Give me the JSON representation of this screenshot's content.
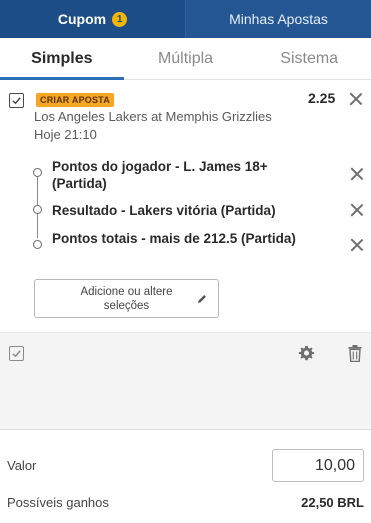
{
  "header": {
    "tabs": [
      {
        "label": "Cupom",
        "badge": "1"
      },
      {
        "label": "Minhas Apostas"
      }
    ]
  },
  "bet_type_tabs": [
    {
      "label": "Simples"
    },
    {
      "label": "Múltipla"
    },
    {
      "label": "Sistema"
    }
  ],
  "bet": {
    "tag": "CRIAR APOSTA",
    "odds": "2.25",
    "match": "Los Angeles Lakers at Memphis Grizzlies",
    "time": "Hoje 21:10",
    "selections": [
      {
        "label": "Pontos do jogador - L. James 18+ (Partida)"
      },
      {
        "label": "Resultado - Lakers vitória (Partida)"
      },
      {
        "label": "Pontos totais - mais de 212.5 (Partida)"
      }
    ],
    "edit_button": "Adicione ou altere seleções"
  },
  "footer": {
    "valor_label": "Valor",
    "valor_value": "10,00",
    "ganhos_label": "Possíveis ganhos",
    "ganhos_value": "22,50 BRL"
  },
  "colors": {
    "header_bg": "#1d4d86",
    "accent": "#2b6fb8",
    "tag_bg": "#f6a623",
    "badge": "#f2b705"
  }
}
